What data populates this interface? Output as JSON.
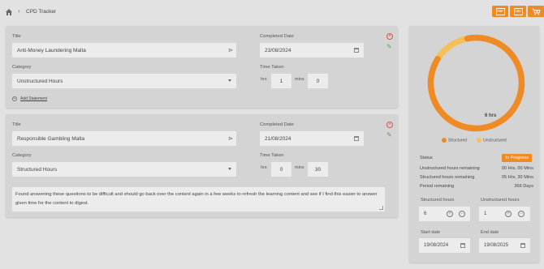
{
  "breadcrumb": {
    "page": "CPD Tracker"
  },
  "exports": [
    {
      "label": "PDF"
    },
    {
      "label": "CSV"
    },
    {
      "label": ""
    }
  ],
  "entries": [
    {
      "title_label": "Title",
      "title": "Anti-Money Laundering Malta",
      "completed_label": "Completed Date",
      "completed_date": "23/08/2024",
      "category_label": "Category",
      "category": "Unstructured Hours",
      "time_label": "Time Taken",
      "hrs_label": "hrs",
      "hrs": "1",
      "mins_label": "mins",
      "mins": "0",
      "add_statement": "Add Statement"
    },
    {
      "title_label": "Title",
      "title": "Responsible Gambling Malta",
      "completed_label": "Completed Date",
      "completed_date": "21/08/2024",
      "category_label": "Category",
      "category": "Structured Hours",
      "time_label": "Time Taken",
      "hrs_label": "hrs",
      "hrs": "0",
      "mins_label": "mins",
      "mins": "30",
      "statement": "Found answering these questions to be difficult and should go back over the content again in a few weeks to refresh the learning content and see if I find this easier to answer given time for the content to digest."
    }
  ],
  "summary": {
    "chart_total": "6 hrs",
    "legend": [
      {
        "label": "Structured",
        "color": "#f08a24"
      },
      {
        "label": "Unstructured",
        "color": "#f5c05a"
      }
    ],
    "chart_data": {
      "type": "pie",
      "categories": [
        "Structured",
        "Unstructured"
      ],
      "values": [
        0.87,
        0.13
      ]
    },
    "status_label": "Status",
    "status": "In Progress",
    "rows": [
      {
        "label": "Unstructured hours remaining",
        "value": "00 Hrs, 00 Mins"
      },
      {
        "label": "Structured hours remaining",
        "value": "05 Hrs, 30 Mins"
      },
      {
        "label": "Period remaining",
        "value": "366 Days"
      }
    ],
    "structured_label": "Structured hours",
    "structured": "6",
    "unstructured_label": "Unstructured hours",
    "unstructured": "1",
    "start_label": "Start date",
    "start": "19/08/2024",
    "end_label": "End date",
    "end": "19/08/2025"
  },
  "colors": {
    "accent": "#f08a24",
    "secondary": "#f5c05a",
    "delete": "#e05050",
    "attach": "#4caf50"
  }
}
